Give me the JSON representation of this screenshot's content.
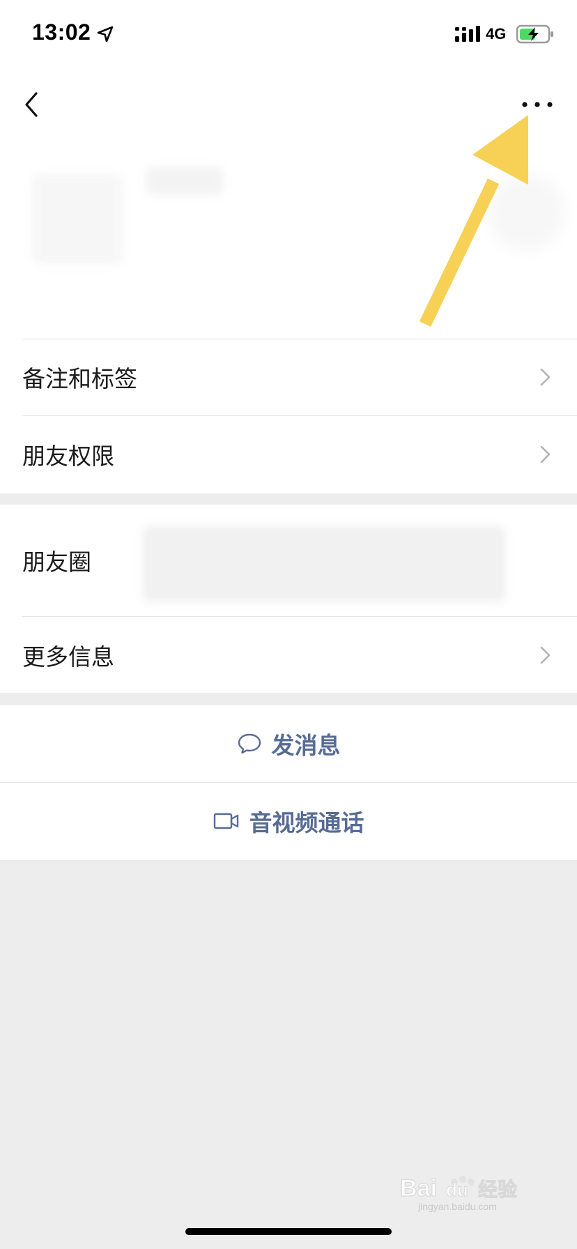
{
  "status_bar": {
    "time": "13:02",
    "network": "4G",
    "location_icon": "location-arrow-icon",
    "signal_icon": "cellular-signal-icon",
    "battery_icon": "battery-charging-icon",
    "battery_color": "#4cd964"
  },
  "nav": {
    "back_icon": "chevron-left-icon",
    "more_icon": "more-dots-icon"
  },
  "annotation": {
    "arrow_color": "#f6d155"
  },
  "menu": {
    "remarks_label": "备注和标签",
    "permissions_label": "朋友权限",
    "moments_label": "朋友圈",
    "more_info_label": "更多信息"
  },
  "actions": {
    "message_label": "发消息",
    "call_label": "音视频通话",
    "message_icon": "chat-bubble-icon",
    "call_icon": "video-camera-icon",
    "accent_color": "#576b95"
  },
  "watermark": {
    "text": "Baidu经验",
    "subtext": "jingyan.baidu.com"
  }
}
